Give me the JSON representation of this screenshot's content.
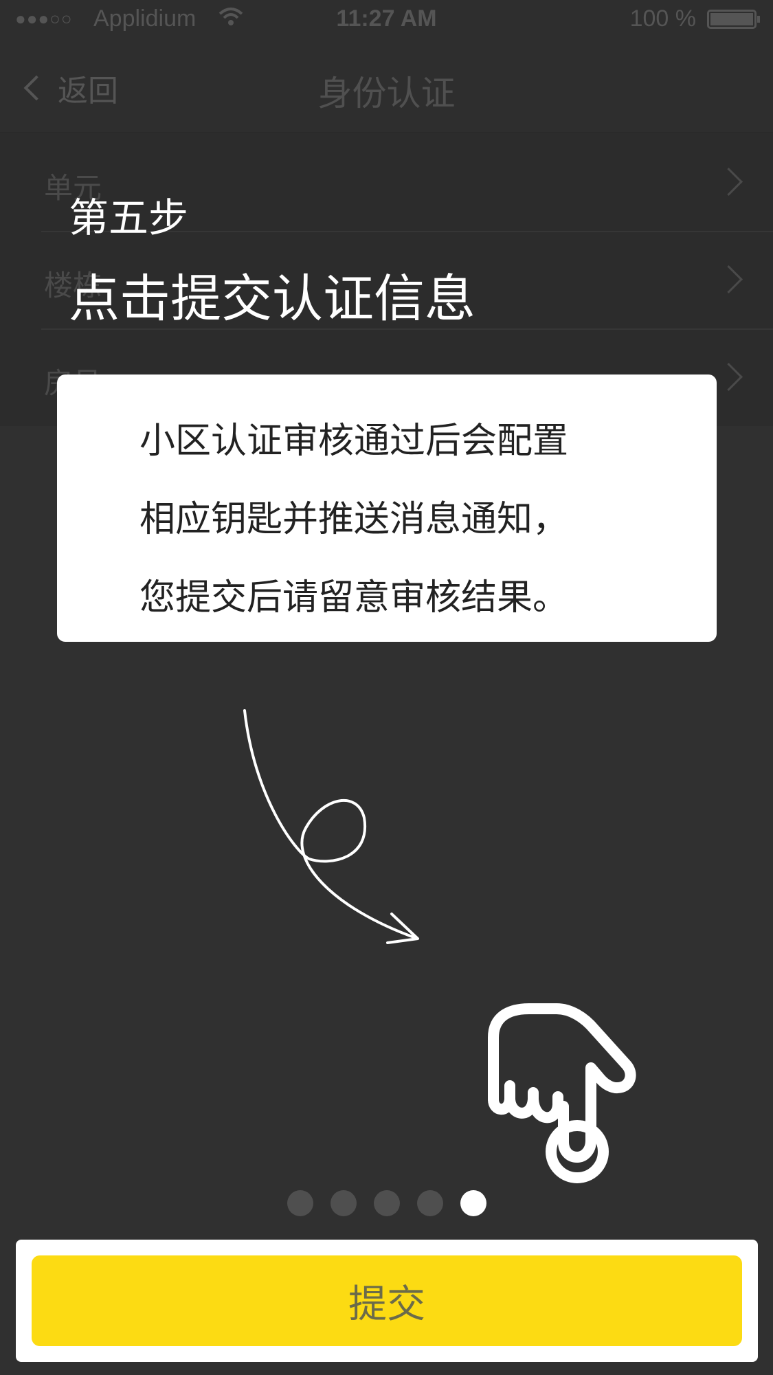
{
  "status_bar": {
    "signal": "●●●○○",
    "carrier": "Applidium",
    "time": "11:27 AM",
    "battery": "100 %"
  },
  "nav": {
    "back_label": "返回",
    "title": "身份认证"
  },
  "form": {
    "rows": [
      {
        "label": "单元"
      },
      {
        "label": "楼栋"
      },
      {
        "label": "房号"
      }
    ]
  },
  "guide": {
    "step": "第五步",
    "instruction": "点击提交认证信息",
    "card_lines": [
      "小区认证审核通过后会配置",
      "相应钥匙并推送消息通知，",
      "您提交后请留意审核结果。"
    ],
    "page_count": 5,
    "current_page": 5
  },
  "footer": {
    "submit_label": "提交"
  },
  "colors": {
    "overlay_bg": "#303030",
    "accent": "#fcdb13",
    "card_bg": "#ffffff"
  }
}
